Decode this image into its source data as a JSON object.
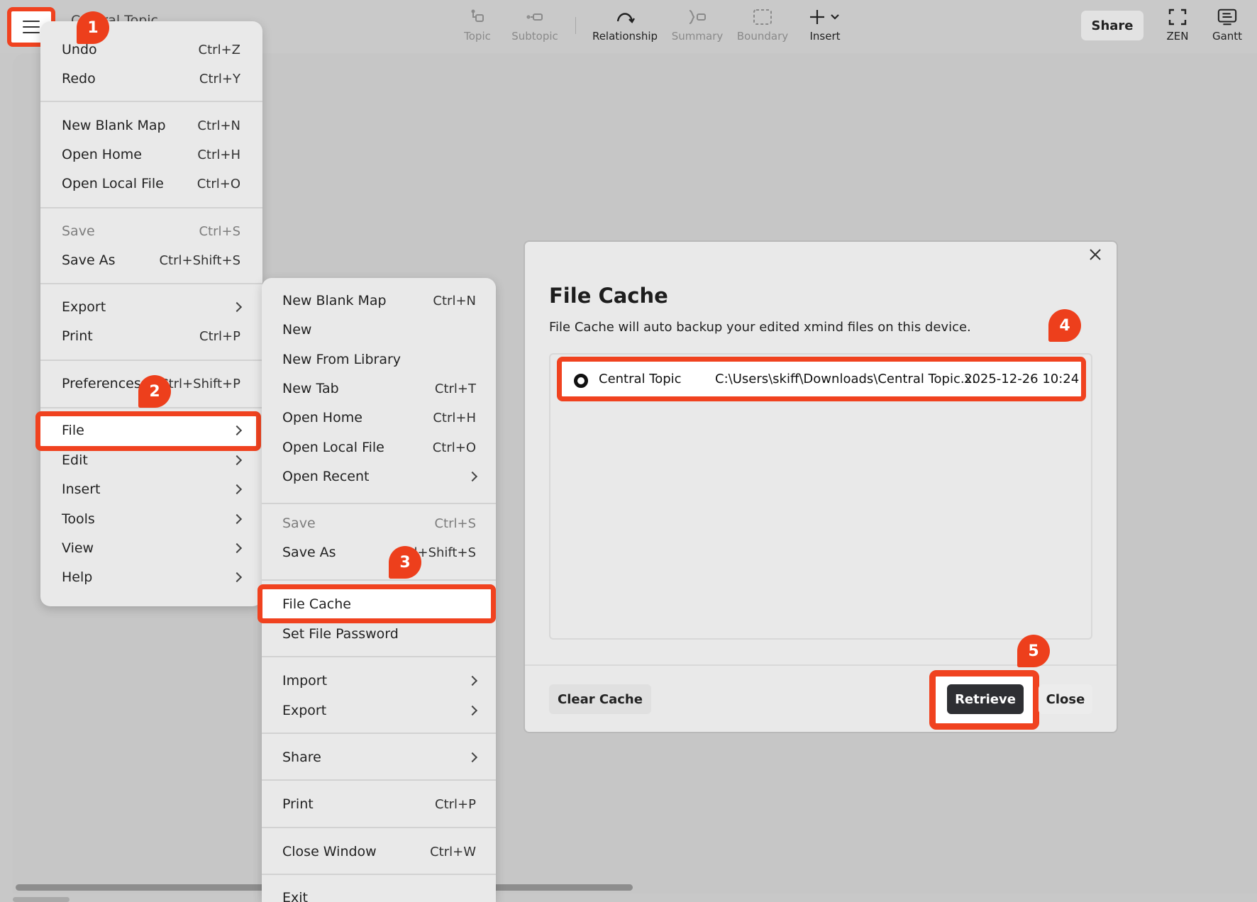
{
  "header": {
    "doc_title": "Central Topic",
    "tools": [
      {
        "label": "Topic",
        "icon": "topic-icon"
      },
      {
        "label": "Subtopic",
        "icon": "subtopic-icon"
      },
      {
        "label": "Relationship",
        "icon": "relationship-icon"
      },
      {
        "label": "Summary",
        "icon": "summary-icon"
      },
      {
        "label": "Boundary",
        "icon": "boundary-icon"
      },
      {
        "label": "Insert",
        "icon": "plus-icon"
      }
    ],
    "share_label": "Share",
    "zen_label": "ZEN",
    "gantt_label": "Gantt"
  },
  "main_menu": {
    "items": [
      {
        "label": "Undo",
        "shortcut": "Ctrl+Z"
      },
      {
        "label": "Redo",
        "shortcut": "Ctrl+Y"
      },
      {
        "label": "New Blank Map",
        "shortcut": "Ctrl+N"
      },
      {
        "label": "Open Home",
        "shortcut": "Ctrl+H"
      },
      {
        "label": "Open Local File",
        "shortcut": "Ctrl+O"
      },
      {
        "label": "Save",
        "shortcut": "Ctrl+S"
      },
      {
        "label": "Save As",
        "shortcut": "Ctrl+Shift+S"
      },
      {
        "label": "Export",
        "shortcut": ""
      },
      {
        "label": "Print",
        "shortcut": "Ctrl+P"
      },
      {
        "label": "Preferences",
        "shortcut": "Ctrl+Shift+P"
      },
      {
        "label": "File",
        "shortcut": ""
      },
      {
        "label": "Edit",
        "shortcut": ""
      },
      {
        "label": "Insert",
        "shortcut": ""
      },
      {
        "label": "Tools",
        "shortcut": ""
      },
      {
        "label": "View",
        "shortcut": ""
      },
      {
        "label": "Help",
        "shortcut": ""
      }
    ]
  },
  "file_menu": {
    "items": [
      {
        "label": "New Blank Map",
        "shortcut": "Ctrl+N"
      },
      {
        "label": "New",
        "shortcut": ""
      },
      {
        "label": "New From Library",
        "shortcut": ""
      },
      {
        "label": "New Tab",
        "shortcut": "Ctrl+T"
      },
      {
        "label": "Open Home",
        "shortcut": "Ctrl+H"
      },
      {
        "label": "Open Local File",
        "shortcut": "Ctrl+O"
      },
      {
        "label": "Open Recent",
        "shortcut": ""
      },
      {
        "label": "Save",
        "shortcut": "Ctrl+S"
      },
      {
        "label": "Save As",
        "shortcut": "Ctrl+Shift+S"
      },
      {
        "label": "File Cache",
        "shortcut": ""
      },
      {
        "label": "Set File Password",
        "shortcut": ""
      },
      {
        "label": "Import",
        "shortcut": ""
      },
      {
        "label": "Export",
        "shortcut": ""
      },
      {
        "label": "Share",
        "shortcut": ""
      },
      {
        "label": "Print",
        "shortcut": "Ctrl+P"
      },
      {
        "label": "Close Window",
        "shortcut": "Ctrl+W"
      },
      {
        "label": "Exit",
        "shortcut": ""
      }
    ]
  },
  "dialog": {
    "title": "File Cache",
    "description": "File Cache will auto backup your edited xmind files on this device.",
    "entries": [
      {
        "name": "Central Topic",
        "path": "C:\\Users\\skiff\\Downloads\\Central Topic.x...",
        "date": "2025-12-26 10:24"
      }
    ],
    "clear_label": "Clear Cache",
    "retrieve_label": "Retrieve",
    "close_label": "Close"
  },
  "callouts": [
    "1",
    "2",
    "3",
    "4",
    "5"
  ],
  "colors": {
    "highlight": "#f0421f",
    "callout": "#ed3f1c",
    "primary_button": "#2e2f33"
  }
}
